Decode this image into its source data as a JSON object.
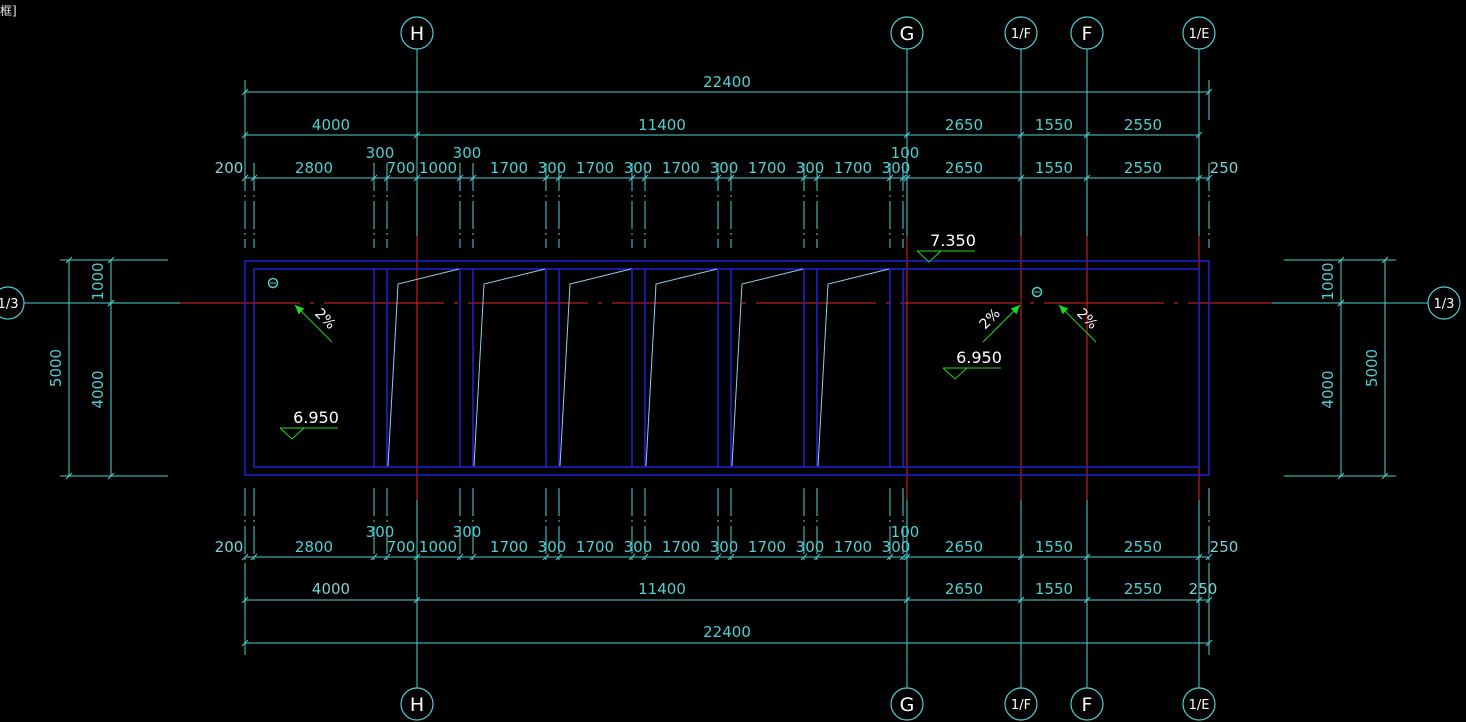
{
  "header": {
    "corner_text": "框]"
  },
  "colors": {
    "background": "#000000",
    "dimension": "#4ecfd2",
    "dimension_light": "#7fd4d6",
    "axis": "#e62020",
    "outline": "#2323d6",
    "stair": "#8fd0e6",
    "annotation": "#1fd81f",
    "text": "#ffffff"
  },
  "axes_top": [
    "H",
    "G",
    "1/F",
    "F",
    "1/E"
  ],
  "axes_bottom": [
    "H",
    "G",
    "1/F",
    "F",
    "1/E"
  ],
  "axis_left": "1/3",
  "axis_right": "1/3",
  "dimensions": {
    "top_total": "22400",
    "top_main": [
      "4000",
      "11400",
      "2650",
      "1550",
      "2550"
    ],
    "top_detail": [
      "200",
      "2800",
      "300",
      "700",
      "1000",
      "300",
      "1700",
      "300",
      "1700",
      "300",
      "1700",
      "300",
      "1700",
      "300",
      "1700",
      "300",
      "100",
      "2650",
      "1550",
      "2550",
      "250"
    ],
    "bottom_detail": [
      "200",
      "2800",
      "300",
      "700",
      "1000",
      "300",
      "1700",
      "300",
      "1700",
      "300",
      "1700",
      "300",
      "1700",
      "300",
      "1700",
      "300",
      "100",
      "2650",
      "1550",
      "2550",
      "250"
    ],
    "bottom_main": [
      "4000",
      "11400",
      "2650",
      "1550",
      "2550",
      "250"
    ],
    "bottom_total": "22400",
    "left": [
      "1000",
      "4000",
      "5000"
    ],
    "right": [
      "1000",
      "4000",
      "5000"
    ]
  },
  "elevations": [
    "7.350",
    "6.950",
    "6.950"
  ],
  "slopes": [
    "2%",
    "2%",
    "2%"
  ],
  "drain_icons": [
    "drain-icon",
    "drain-icon"
  ]
}
